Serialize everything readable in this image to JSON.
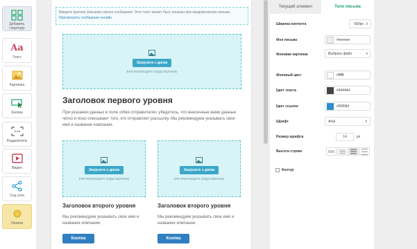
{
  "sidebar": {
    "items": [
      {
        "label": "Добавить структуру",
        "icon": "grid-icon"
      },
      {
        "label": "Текст",
        "icon": "text-aa-icon"
      },
      {
        "label": "Картинка",
        "icon": "image-icon"
      },
      {
        "label": "Кнопка",
        "icon": "button-cursor-icon"
      },
      {
        "label": "Разделитель",
        "icon": "divider-icon"
      },
      {
        "label": "Видео",
        "icon": "video-play-icon"
      },
      {
        "label": "Соц сети",
        "icon": "share-icon"
      },
      {
        "label": "Оплата",
        "icon": "payment-icon"
      }
    ]
  },
  "canvas": {
    "preheader_text": "Введите краткое описание своего сообщения. Этот текст может быть показан при предпросмотре письма. ",
    "preheader_link": "Просмотреть сообщение онлайн",
    "upload_label": "Загрузите с диска",
    "drag_text": "или перетащите сюда картинку",
    "h1": "Заголовок первого уровня",
    "p1": "При указании данных в поле «Имя отправителя» убедитесь, что внесенные вами данные четко и ясно описывают того, кто отправляет рассылку. Мы рекомендуем указывать свое имя и название компании.",
    "columns": [
      {
        "h2": "Заголовок второго уровня",
        "text": "Мы рекомендуем указывать свое имя и название компании.",
        "button": "Кнопка"
      },
      {
        "h2": "Заголовок второго уровня",
        "text": "Мы рекомендуем указывать свое имя и название компании.",
        "button": "Кнопка"
      }
    ]
  },
  "panel": {
    "tabs": [
      "Текущий элемент",
      "Тело письма"
    ],
    "active_tab": "Тело письма",
    "content_width_label": "Ширина контента",
    "content_width_value": "600px",
    "bg_label": "Фон письма",
    "bg_value": "#eeeeee",
    "bg_image_label": "Фоновая картинка",
    "bg_image_value": "Выбрать файл",
    "bg_color_label": "Фоновый цвет",
    "bg_color_value": "#ffffff",
    "text_color_label": "Цвет текста",
    "text_color_value": "#444444",
    "link_color_label": "Цвет ссылок",
    "link_color_value": "#0089bf",
    "font_label": "Шрифт",
    "font_value": "Arial",
    "font_size_label": "Размер шрифта",
    "font_size_value": "14",
    "font_size_unit": "px",
    "line_height_label": "Высота строки",
    "outline_label": "Контур"
  },
  "colors": {
    "accent_green": "#1ea26c",
    "button_blue": "#2f7fc1",
    "upload_blue": "#3aa7c8",
    "link_swatch": "#0089bf",
    "text_swatch": "#444444"
  }
}
